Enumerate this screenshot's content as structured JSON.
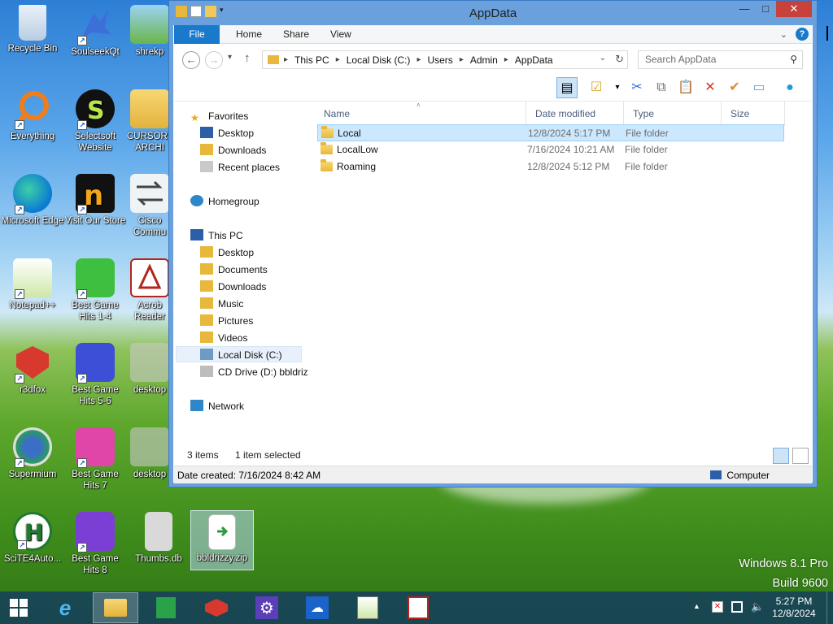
{
  "desktop": {
    "icons": [
      {
        "label": "Recycle Bin"
      },
      {
        "label": "SoulseekQt"
      },
      {
        "label": "shrekp"
      },
      {
        "label": "Everything"
      },
      {
        "label": "Selectsoft Website"
      },
      {
        "label": "CURSORS ARCHI"
      },
      {
        "label": "Microsoft Edge"
      },
      {
        "label": "Visit Our Store"
      },
      {
        "label": "Cisco Commu"
      },
      {
        "label": "Notepad++"
      },
      {
        "label": "Best Game Hits 1-4"
      },
      {
        "label": "Acrob Reader"
      },
      {
        "label": "r3dfox"
      },
      {
        "label": "Best Game Hits 5-6"
      },
      {
        "label": "desktop"
      },
      {
        "label": "Supermium"
      },
      {
        "label": "Best Game Hits 7"
      },
      {
        "label": "desktop"
      },
      {
        "label": "SciTE4Auto..."
      },
      {
        "label": "Best Game Hits 8"
      },
      {
        "label": "Thumbs.db"
      },
      {
        "label": "bbldrizzy.zip"
      }
    ],
    "watermark": {
      "line1": "Windows 8.1 Pro",
      "line2": "Build 9600"
    }
  },
  "window": {
    "title": "AppData",
    "ribbon_tabs": [
      "File",
      "Home",
      "Share",
      "View"
    ],
    "breadcrumb": [
      "This PC",
      "Local Disk (C:)",
      "Users",
      "Admin",
      "AppData"
    ],
    "search_placeholder": "Search AppData",
    "nav": {
      "favorites": "Favorites",
      "fav_items": [
        "Desktop",
        "Downloads",
        "Recent places"
      ],
      "homegroup": "Homegroup",
      "thispc": "This PC",
      "pc_items": [
        "Desktop",
        "Documents",
        "Downloads",
        "Music",
        "Pictures",
        "Videos",
        "Local Disk (C:)",
        "CD Drive (D:) bbldriz"
      ],
      "network": "Network"
    },
    "columns": [
      "Name",
      "Date modified",
      "Type",
      "Size"
    ],
    "rows": [
      {
        "name": "Local",
        "date": "12/8/2024 5:17 PM",
        "type": "File folder",
        "selected": true
      },
      {
        "name": "LocalLow",
        "date": "7/16/2024 10:21 AM",
        "type": "File folder",
        "selected": false
      },
      {
        "name": "Roaming",
        "date": "12/8/2024 5:12 PM",
        "type": "File folder",
        "selected": false
      }
    ],
    "status": {
      "items": "3 items",
      "selected": "1 item selected"
    },
    "details": {
      "date_created": "Date created: 7/16/2024 8:42 AM",
      "location": "Computer"
    }
  },
  "taskbar": {
    "clock_time": "5:27 PM",
    "clock_date": "12/8/2024"
  },
  "colors": {
    "accent": "#1979ca",
    "selection": "#cce8ff",
    "close": "#c7423b"
  }
}
